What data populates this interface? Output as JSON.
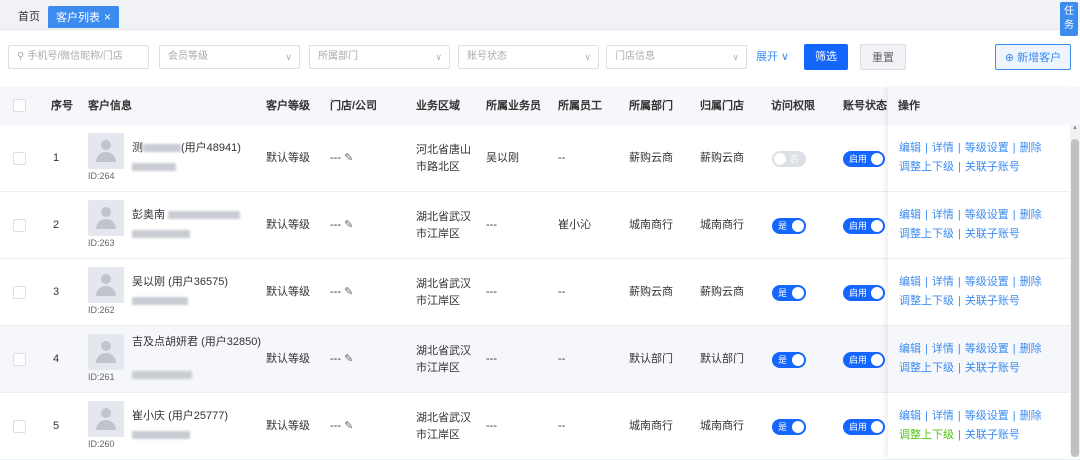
{
  "tabs": {
    "home": "首页",
    "active": "客户列表",
    "close": "×",
    "task": "任务"
  },
  "filters": {
    "search_placeholder": "手机号/微信昵称/门店",
    "member_level": "会员等级",
    "department": "所属部门",
    "account_status": "账号状态",
    "store_info": "门店信息",
    "expand": "展开",
    "filter": "筛选",
    "reset": "重置",
    "add": "新增客户"
  },
  "columns": [
    "序号",
    "客户信息",
    "客户等级",
    "门店/公司",
    "业务区域",
    "所属业务员",
    "所属员工",
    "所属部门",
    "归属门店",
    "访问权限",
    "账号状态",
    "操作"
  ],
  "ops": {
    "edit": "编辑",
    "detail": "详情",
    "level": "等级设置",
    "delete": "删除",
    "adjust": "调整上下级",
    "link": "关联子账号"
  },
  "rows": [
    {
      "no": "1",
      "name": "测",
      "user_id": "(用户48941)",
      "id": "ID:264",
      "level": "默认等级",
      "store": "---",
      "region": "河北省唐山市路北区",
      "salesman": "吴以刚",
      "staff": "--",
      "dept": "薪购云商",
      "home_store": "薪购云商",
      "access": "否",
      "status": "启用"
    },
    {
      "no": "2",
      "name": "彭奥南",
      "user_id": "",
      "id": "ID:263",
      "level": "默认等级",
      "store": "---",
      "region": "湖北省武汉市江岸区",
      "salesman": "---",
      "staff": "崔小沁",
      "dept": "城南商行",
      "home_store": "城南商行",
      "access": "是",
      "status": "启用"
    },
    {
      "no": "3",
      "name": "吴以刚",
      "user_id": "(用户36575)",
      "id": "ID:262",
      "level": "默认等级",
      "store": "---",
      "region": "湖北省武汉市江岸区",
      "salesman": "---",
      "staff": "--",
      "dept": "薪购云商",
      "home_store": "薪购云商",
      "access": "是",
      "status": "启用"
    },
    {
      "no": "4",
      "name": "吉及点胡妍君",
      "user_id": "(用户32850)",
      "id": "ID:261",
      "level": "默认等级",
      "store": "---",
      "region": "湖北省武汉市江岸区",
      "salesman": "---",
      "staff": "--",
      "dept": "默认部门",
      "home_store": "默认部门",
      "access": "是",
      "status": "启用"
    },
    {
      "no": "5",
      "name": "崔小庆",
      "user_id": "(用户25777)",
      "id": "ID:260",
      "level": "默认等级",
      "store": "---",
      "region": "湖北省武汉市江岸区",
      "salesman": "---",
      "staff": "--",
      "dept": "城南商行",
      "home_store": "城南商行",
      "access": "是",
      "status": "启用"
    }
  ]
}
